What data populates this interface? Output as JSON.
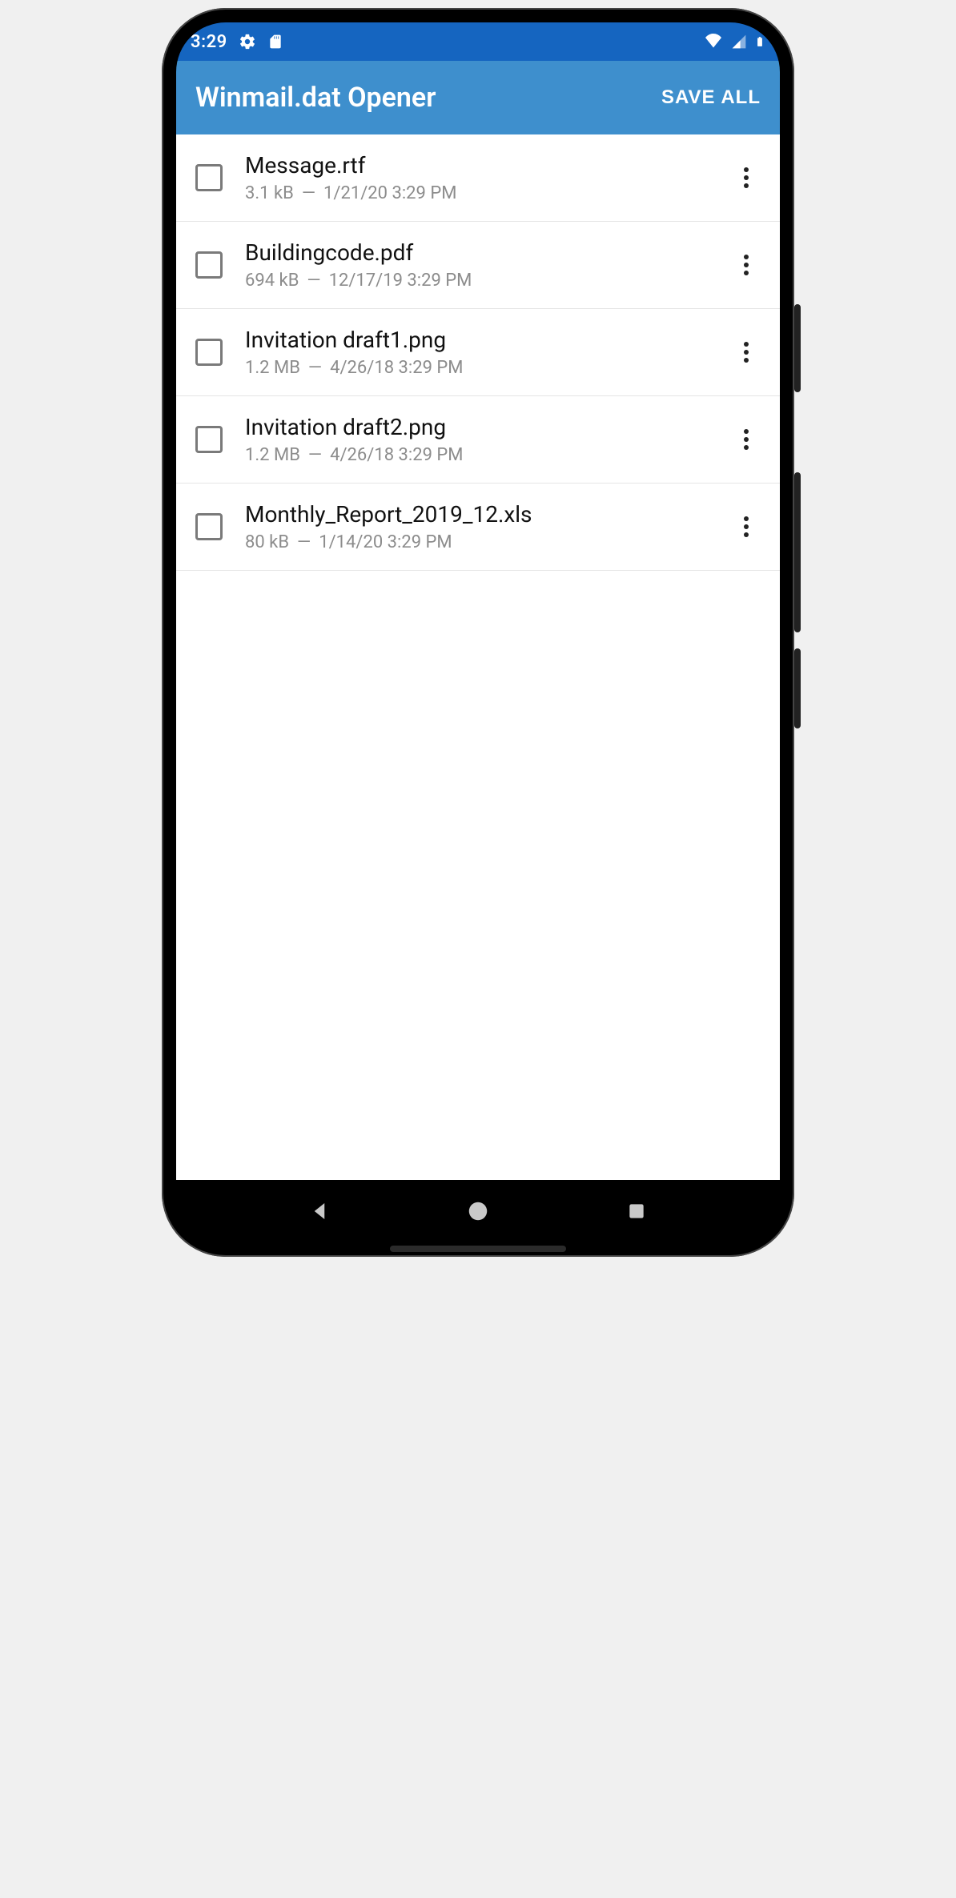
{
  "status": {
    "time": "3:29"
  },
  "appbar": {
    "title": "Winmail.dat Opener",
    "action": "SAVE ALL"
  },
  "files": [
    {
      "name": "Message.rtf",
      "size": "3.1 kB",
      "date": "1/21/20 3:29 PM"
    },
    {
      "name": "Buildingcode.pdf",
      "size": "694 kB",
      "date": "12/17/19 3:29 PM"
    },
    {
      "name": "Invitation draft1.png",
      "size": "1.2 MB",
      "date": "4/26/18 3:29 PM"
    },
    {
      "name": "Invitation draft2.png",
      "size": "1.2 MB",
      "date": "4/26/18 3:29 PM"
    },
    {
      "name": "Monthly_Report_2019_12.xls",
      "size": "80 kB",
      "date": "1/14/20 3:29 PM"
    }
  ]
}
